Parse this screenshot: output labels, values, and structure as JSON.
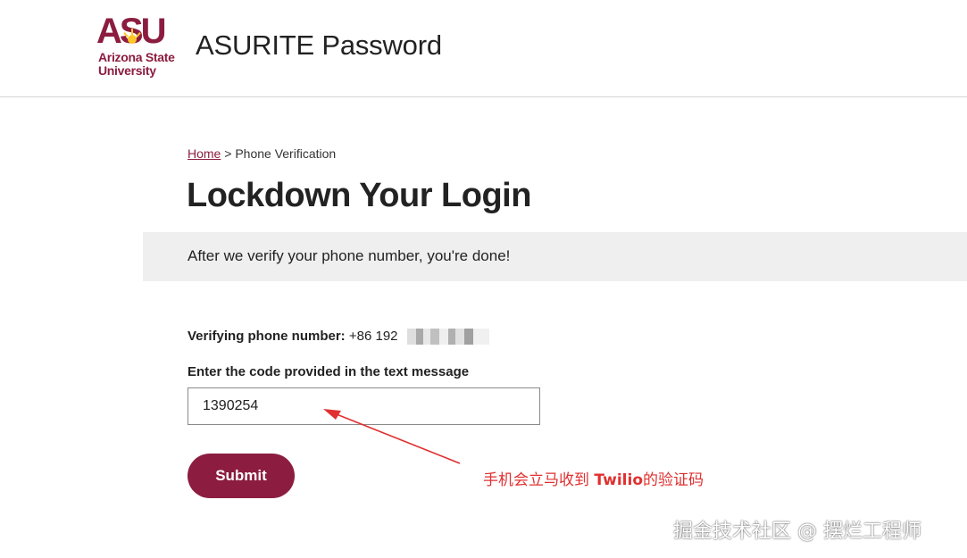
{
  "colors": {
    "accent": "#8c1d40",
    "annotation": "#e03030",
    "notice_bg": "#efefef"
  },
  "header": {
    "logo_lines": [
      "Arizona State",
      "University"
    ],
    "logo_mark": "ASU",
    "title": "ASURITE Password"
  },
  "breadcrumb": {
    "home": "Home",
    "separator": ">",
    "current": "Phone Verification"
  },
  "page": {
    "title": "Lockdown Your Login",
    "notice": "After we verify your phone number, you're done!"
  },
  "verify": {
    "label": "Verifying phone number:",
    "number": "+86 192"
  },
  "code_field": {
    "label": "Enter the code provided in the text message",
    "value": "1390254"
  },
  "submit_label": "Submit",
  "annotation": {
    "before": "手机会立马收到 ",
    "strong": "Twilio",
    "after": "的验证码"
  },
  "watermark": "掘金技术社区 @ 摆烂工程师"
}
